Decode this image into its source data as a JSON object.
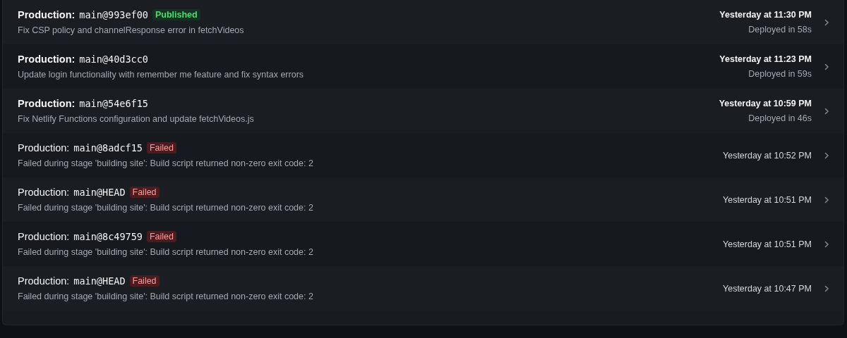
{
  "deploys": [
    {
      "kind": "published",
      "label": "Production:",
      "ref": "main@993ef00",
      "badge": "Published",
      "message": "Fix CSP policy and channelResponse error in fetchVideos",
      "time": "Yesterday at 11:30 PM",
      "duration": "Deployed in 58s"
    },
    {
      "kind": "success",
      "label": "Production:",
      "ref": "main@40d3cc0",
      "message": "Update login functionality with remember me feature and fix syntax errors",
      "time": "Yesterday at 11:23 PM",
      "duration": "Deployed in 59s"
    },
    {
      "kind": "success",
      "label": "Production:",
      "ref": "main@54e6f15",
      "message": "Fix Netlify Functions configuration and update fetchVideos.js",
      "time": "Yesterday at 10:59 PM",
      "duration": "Deployed in 46s"
    },
    {
      "kind": "failed",
      "label": "Production:",
      "ref": "main@8adcf15",
      "badge": "Failed",
      "message": "Failed during stage 'building site': Build script returned non-zero exit code: 2",
      "time": "Yesterday at 10:52 PM"
    },
    {
      "kind": "failed",
      "label": "Production:",
      "ref": "main@HEAD",
      "badge": "Failed",
      "message": "Failed during stage 'building site': Build script returned non-zero exit code: 2",
      "time": "Yesterday at 10:51 PM"
    },
    {
      "kind": "failed",
      "label": "Production:",
      "ref": "main@8c49759",
      "badge": "Failed",
      "message": "Failed during stage 'building site': Build script returned non-zero exit code: 2",
      "time": "Yesterday at 10:51 PM"
    },
    {
      "kind": "failed",
      "label": "Production:",
      "ref": "main@HEAD",
      "badge": "Failed",
      "message": "Failed during stage 'building site': Build script returned non-zero exit code: 2",
      "time": "Yesterday at 10:47 PM"
    }
  ]
}
